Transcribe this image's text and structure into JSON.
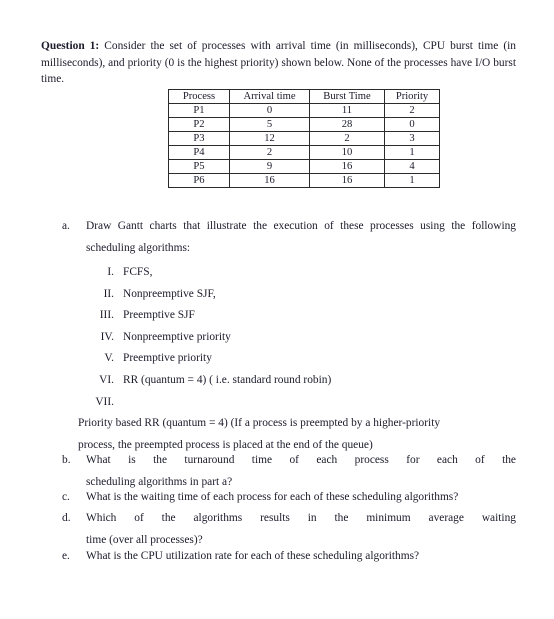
{
  "document": {
    "question_label": "Question 1:",
    "intro_text": " Consider the set of processes with arrival time (in milliseconds), CPU burst time (in milliseconds), and priority (0 is the highest priority) shown below. None of the processes have I/O burst time."
  },
  "table": {
    "headers": [
      "Process",
      "Arrival time",
      "Burst Time",
      "Priority"
    ],
    "rows": [
      {
        "process": "P1",
        "arrival": "0",
        "burst": "11",
        "priority": "2"
      },
      {
        "process": "P2",
        "arrival": "5",
        "burst": "28",
        "priority": "0"
      },
      {
        "process": "P3",
        "arrival": "12",
        "burst": "2",
        "priority": "3"
      },
      {
        "process": "P4",
        "arrival": "2",
        "burst": "10",
        "priority": "1"
      },
      {
        "process": "P5",
        "arrival": "9",
        "burst": "16",
        "priority": "4"
      },
      {
        "process": "P6",
        "arrival": "16",
        "burst": "16",
        "priority": "1"
      }
    ]
  },
  "parts": {
    "a": {
      "marker": "a.",
      "line1": "Draw Gantt charts that illustrate the execution of these processes using the following",
      "line2": "scheduling algorithms:"
    },
    "b": {
      "marker": "b.",
      "line1": "What is the turnaround time of each process for each of the",
      "line2": "scheduling algorithms in part a?"
    },
    "c": {
      "marker": "c.",
      "line1": "What is the waiting time of each process for each of these scheduling algorithms?"
    },
    "d": {
      "marker": "d.",
      "line1": "Which of the algorithms results in the minimum average waiting",
      "line2": "time (over all processes)?"
    },
    "e": {
      "marker": "e.",
      "line1": "What is the CPU utilization rate for each of these scheduling algorithms?"
    }
  },
  "algorithms": [
    {
      "numeral": "I.",
      "text": "FCFS,"
    },
    {
      "numeral": "II.",
      "text": "Nonpreemptive SJF,"
    },
    {
      "numeral": "III.",
      "text": "Preemptive SJF"
    },
    {
      "numeral": "IV.",
      "text": "Nonpreemptive priority"
    },
    {
      "numeral": "V.",
      "text": "Preemptive priority"
    },
    {
      "numeral": "VI.",
      "text": "RR (quantum = 4) ( i.e. standard round robin)"
    },
    {
      "numeral": "VII.",
      "text": "Priority based RR (quantum = 4) (If a process is preempted by a higher-priority",
      "text2": "process, the preempted process is placed at the end of the queue)"
    }
  ]
}
